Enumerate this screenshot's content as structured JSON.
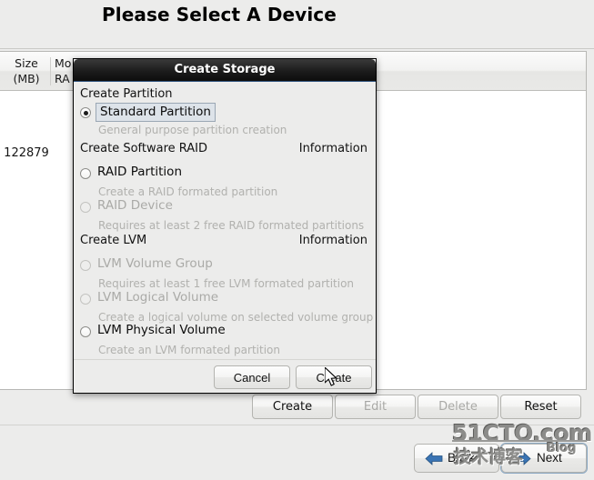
{
  "window": {
    "header_title": "Please Select A Device"
  },
  "device_table": {
    "columns": [
      {
        "line1": "Size",
        "line2": "(MB)"
      },
      {
        "line1": "Mo",
        "line2": "RA"
      }
    ],
    "rows": [
      {
        "size": "122879"
      }
    ]
  },
  "action_buttons": [
    {
      "label": "Create",
      "enabled": "true"
    },
    {
      "label": "Edit",
      "enabled": "false"
    },
    {
      "label": "Delete",
      "enabled": "false"
    },
    {
      "label": "Reset",
      "enabled": "true"
    }
  ],
  "navigation": {
    "back_label": "Back",
    "next_label": "Next",
    "back_icon": "arrow-left-icon",
    "next_icon": "arrow-right-icon",
    "arrow_color": "#3a74b4"
  },
  "dialog": {
    "title": "Create Storage",
    "groups": [
      {
        "title": "Create Partition",
        "information": "",
        "options": [
          {
            "label": "Standard Partition",
            "desc": "General purpose partition creation",
            "selected": "true",
            "enabled": "true",
            "focused": "true"
          }
        ]
      },
      {
        "title": "Create Software RAID",
        "information": "Information",
        "options": [
          {
            "label": "RAID Partition",
            "desc": "Create a RAID formated partition",
            "selected": "false",
            "enabled": "true",
            "focused": "false"
          },
          {
            "label": "RAID Device",
            "desc": "Requires at least 2 free RAID formated partitions",
            "selected": "false",
            "enabled": "false",
            "focused": "false"
          }
        ]
      },
      {
        "title": "Create LVM",
        "information": "Information",
        "options": [
          {
            "label": "LVM Volume Group",
            "desc": "Requires at least 1 free LVM formated partition",
            "selected": "false",
            "enabled": "false",
            "focused": "false"
          },
          {
            "label": "LVM Logical Volume",
            "desc": "Create a logical volume on selected volume group",
            "selected": "false",
            "enabled": "false",
            "focused": "false"
          },
          {
            "label": "LVM Physical Volume",
            "desc": "Create an LVM formated partition",
            "selected": "false",
            "enabled": "true",
            "focused": "false"
          }
        ]
      }
    ],
    "cancel_label": "Cancel",
    "create_label": "Create"
  },
  "watermark": {
    "main": "51CTO.com",
    "chinese": "技术博客",
    "blog": "Blog"
  },
  "colors": {
    "window_bg": "#ececeb",
    "dialog_titlebar": "#141414",
    "focus_fill": "#dde3e9",
    "disabled_text": "#aaaaa7"
  }
}
